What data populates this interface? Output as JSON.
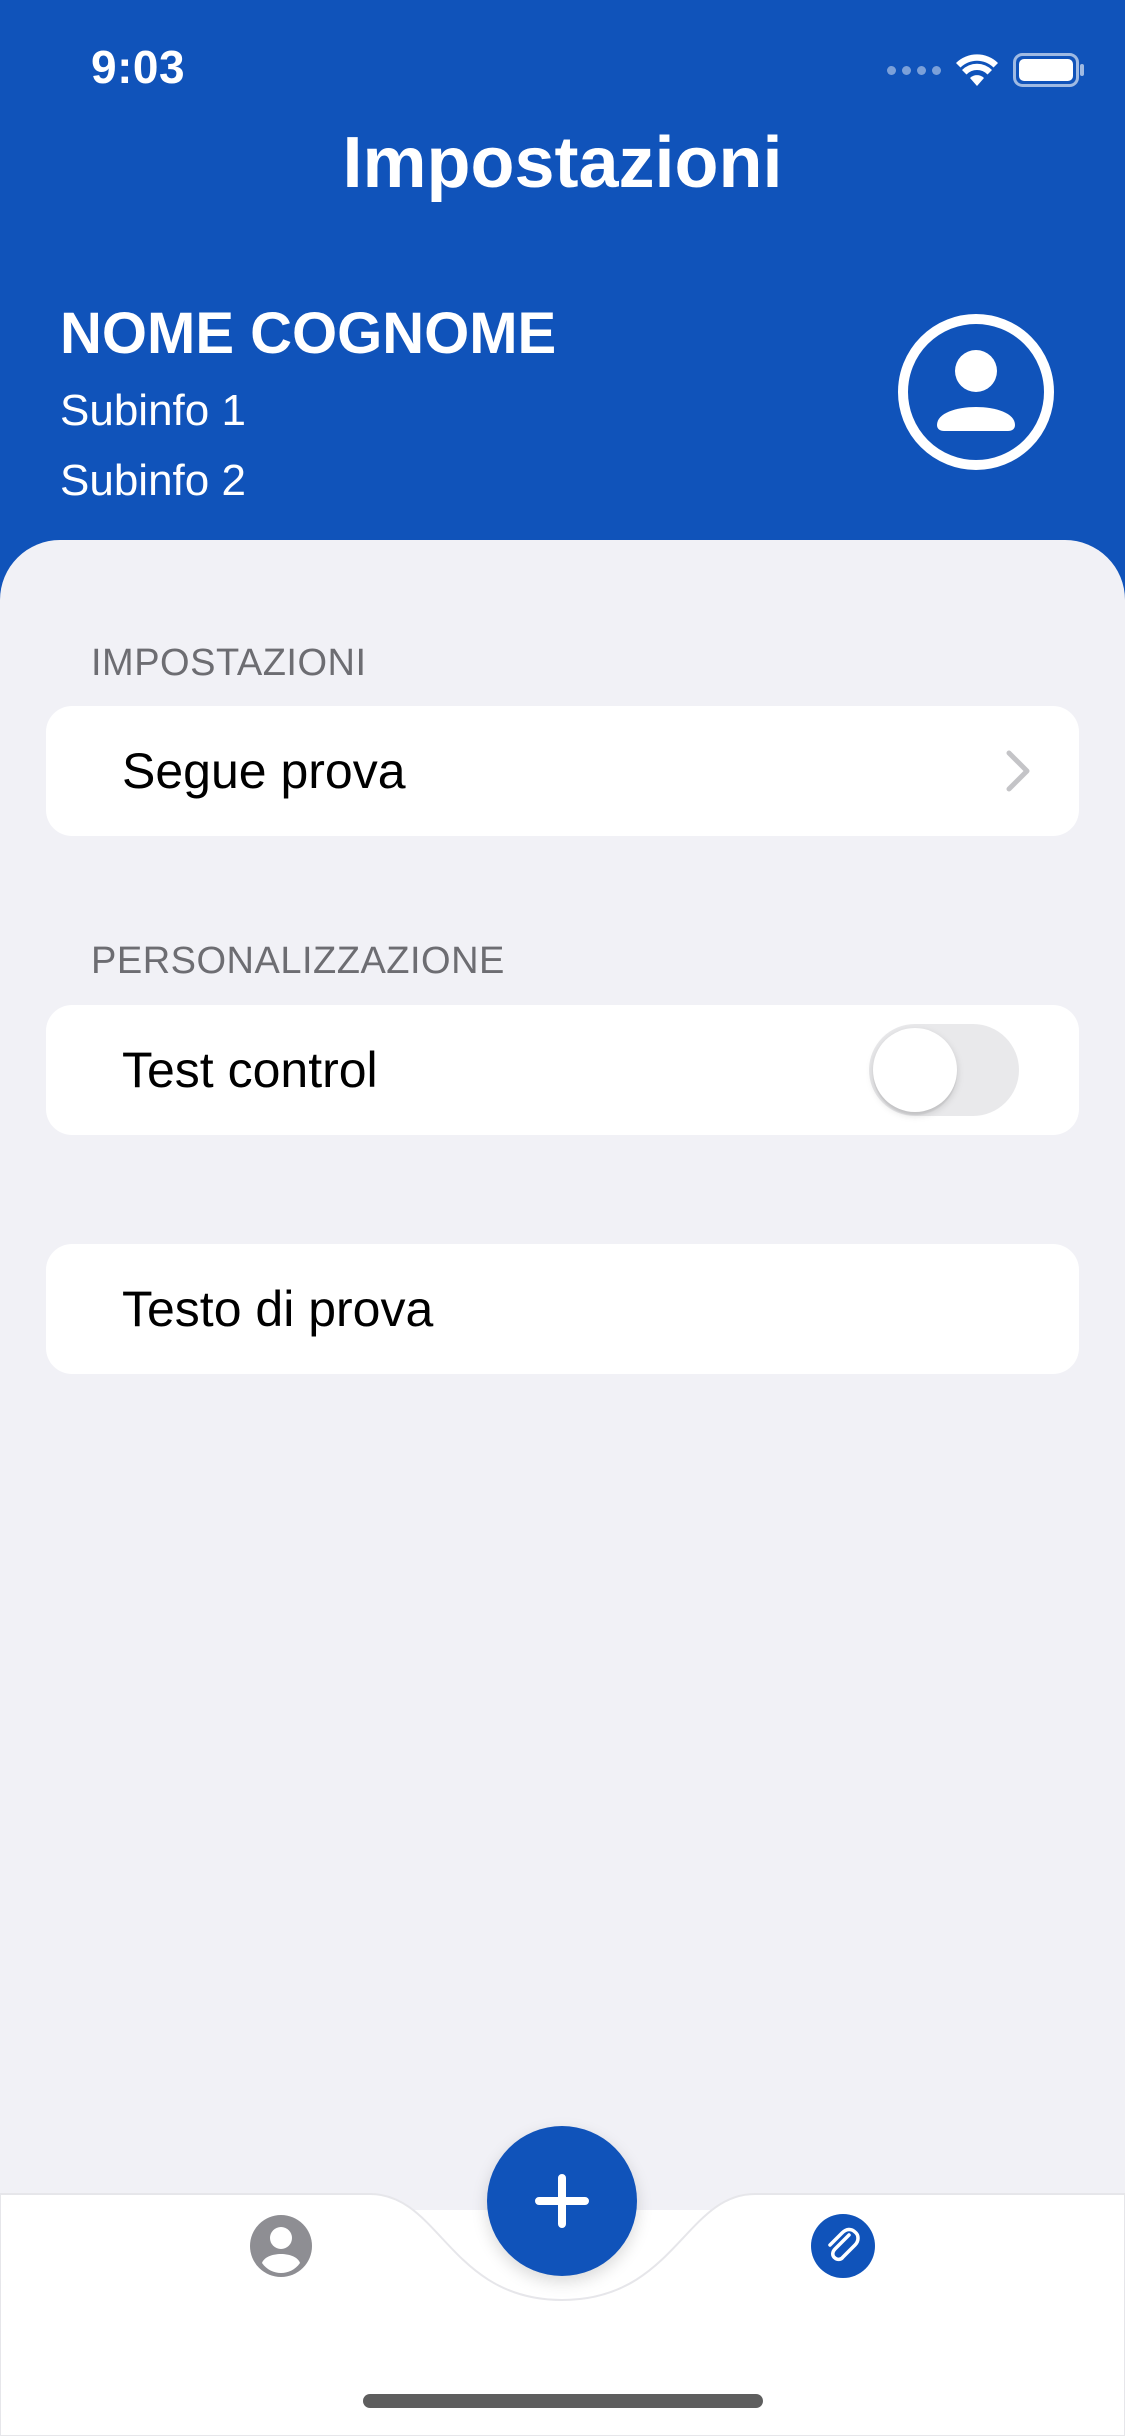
{
  "status_bar": {
    "time": "9:03"
  },
  "header": {
    "title": "Impostazioni"
  },
  "profile": {
    "name": "NOME COGNOME",
    "subinfo_1": "Subinfo 1",
    "subinfo_2": "Subinfo 2",
    "icon": "person-circle-icon"
  },
  "sections": [
    {
      "header": "IMPOSTAZIONI",
      "rows": [
        {
          "label": "Segue prova",
          "accessory": "chevron-right-icon"
        }
      ]
    },
    {
      "header": "PERSONALIZZAZIONE",
      "rows": [
        {
          "label": "Test control",
          "accessory": "toggle",
          "toggle_on": false
        }
      ]
    },
    {
      "header": "",
      "rows": [
        {
          "label": "Testo di prova"
        }
      ]
    }
  ],
  "tab_bar": {
    "left_icon": "person-circle-icon",
    "center_icon": "plus-icon",
    "right_icon": "paperclip-icon"
  },
  "colors": {
    "primary": "#1053BA",
    "background": "#F1F1F6",
    "section_header": "#6D6D72",
    "tab_inactive": "#8E8E93"
  }
}
